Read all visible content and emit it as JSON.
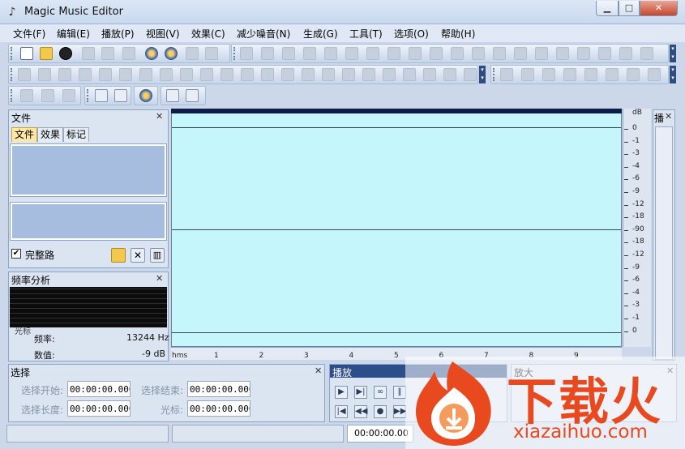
{
  "window": {
    "title": "Magic Music Editor",
    "app_icon": "music-note-icon"
  },
  "menu": [
    {
      "label": "文件(F)"
    },
    {
      "label": "编辑(E)"
    },
    {
      "label": "播放(P)"
    },
    {
      "label": "视图(V)"
    },
    {
      "label": "效果(C)"
    },
    {
      "label": "减少噪音(N)"
    },
    {
      "label": "生成(G)"
    },
    {
      "label": "工具(T)"
    },
    {
      "label": "选项(O)"
    },
    {
      "label": "帮助(H)"
    }
  ],
  "files_panel": {
    "title": "文件",
    "tabs": [
      {
        "label": "文件"
      },
      {
        "label": "效果"
      },
      {
        "label": "标记"
      }
    ],
    "checkbox_label": "完整路"
  },
  "freq_panel": {
    "title": "频率分析",
    "partial_label": "光标",
    "freq_label": "频率:",
    "freq_value": "13244 Hz",
    "value_label": "数值:",
    "value_value": "-9 dB"
  },
  "right_panel": {
    "title": "播"
  },
  "db_scale": {
    "header": "dB",
    "ticks": [
      "0",
      "-1",
      "-3",
      "-4",
      "-6",
      "-9",
      "-12",
      "-18",
      "-90",
      "-18",
      "-12",
      "-9",
      "-6",
      "-4",
      "-3",
      "-1",
      "0"
    ]
  },
  "ruler": {
    "unit": "hms",
    "labels": [
      "1",
      "2",
      "3",
      "4",
      "5",
      "6",
      "7",
      "8",
      "9"
    ]
  },
  "selection_panel": {
    "title": "选择",
    "start_label": "选择开始:",
    "start_value": "00:00:00.000",
    "end_label": "选择结束:",
    "end_value": "00:00:00.000",
    "length_label": "选择长度:",
    "length_value": "00:00:00.000",
    "cursor_label": "光标:",
    "cursor_value": "00:00:00.000"
  },
  "play_panel": {
    "title": "播放"
  },
  "zoom_panel": {
    "title": "放大"
  },
  "status": {
    "time": "00:00:00.00"
  },
  "watermark": {
    "text": "下载火",
    "url": "xiazaihuo.com"
  },
  "colors": {
    "wave_bg": "#c4f6fb",
    "accent": "#e8491e"
  }
}
